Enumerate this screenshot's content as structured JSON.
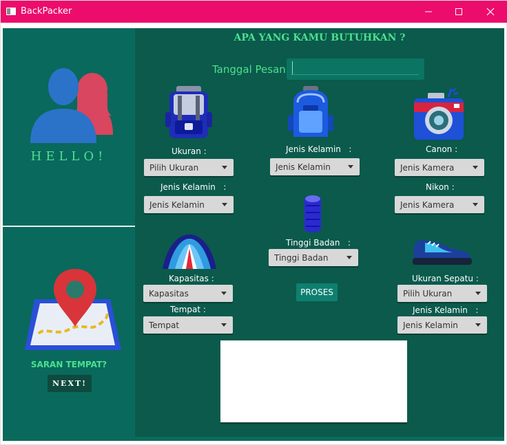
{
  "window": {
    "title": "BackPacker"
  },
  "sidebar": {
    "greeting": "HELLO!",
    "saran_label": "SARAN TEMPAT?",
    "next_button": "NEXT!"
  },
  "main": {
    "heading": "APA YANG KAMU BUTUHKAN ?",
    "tanggal_label": "Tanggal Pesan :",
    "tanggal_value": "",
    "tas": {
      "ukuran_label": "Ukuran :",
      "ukuran_value": "Pilih Ukuran",
      "jenis_label": "Jenis Kelamin   :",
      "jenis_value": "Jenis Kelamin"
    },
    "jaket": {
      "jenis_label": "Jenis Kelamin   :",
      "jenis_value": "Jenis Kelamin"
    },
    "kamera": {
      "canon_label": "Canon :",
      "canon_value": "Jenis Kamera",
      "nikon_label": "Nikon :",
      "nikon_value": "Jenis Kamera"
    },
    "sleeping_bag": {
      "tinggi_label": "Tinggi Badan   :",
      "tinggi_value": "Tinggi Badan"
    },
    "tenda": {
      "kapasitas_label": "Kapasitas :",
      "kapasitas_value": "Kapasitas",
      "tempat_label": "Tempat :",
      "tempat_value": "Tempat"
    },
    "sepatu": {
      "ukuran_label": "Ukuran Sepatu :",
      "ukuran_value": "Pilih Ukuran",
      "jenis_label": "Jenis Kelamin   :",
      "jenis_value": "Jenis Kelamin"
    },
    "proses_button": "PROSES"
  },
  "colors": {
    "titlebar": "#ec0c6c",
    "sidebar": "#09695c",
    "main": "#0b5a4c",
    "accent_text": "#4de08e",
    "next_button": "#0e4a3e",
    "proses_button": "#0e8070"
  }
}
